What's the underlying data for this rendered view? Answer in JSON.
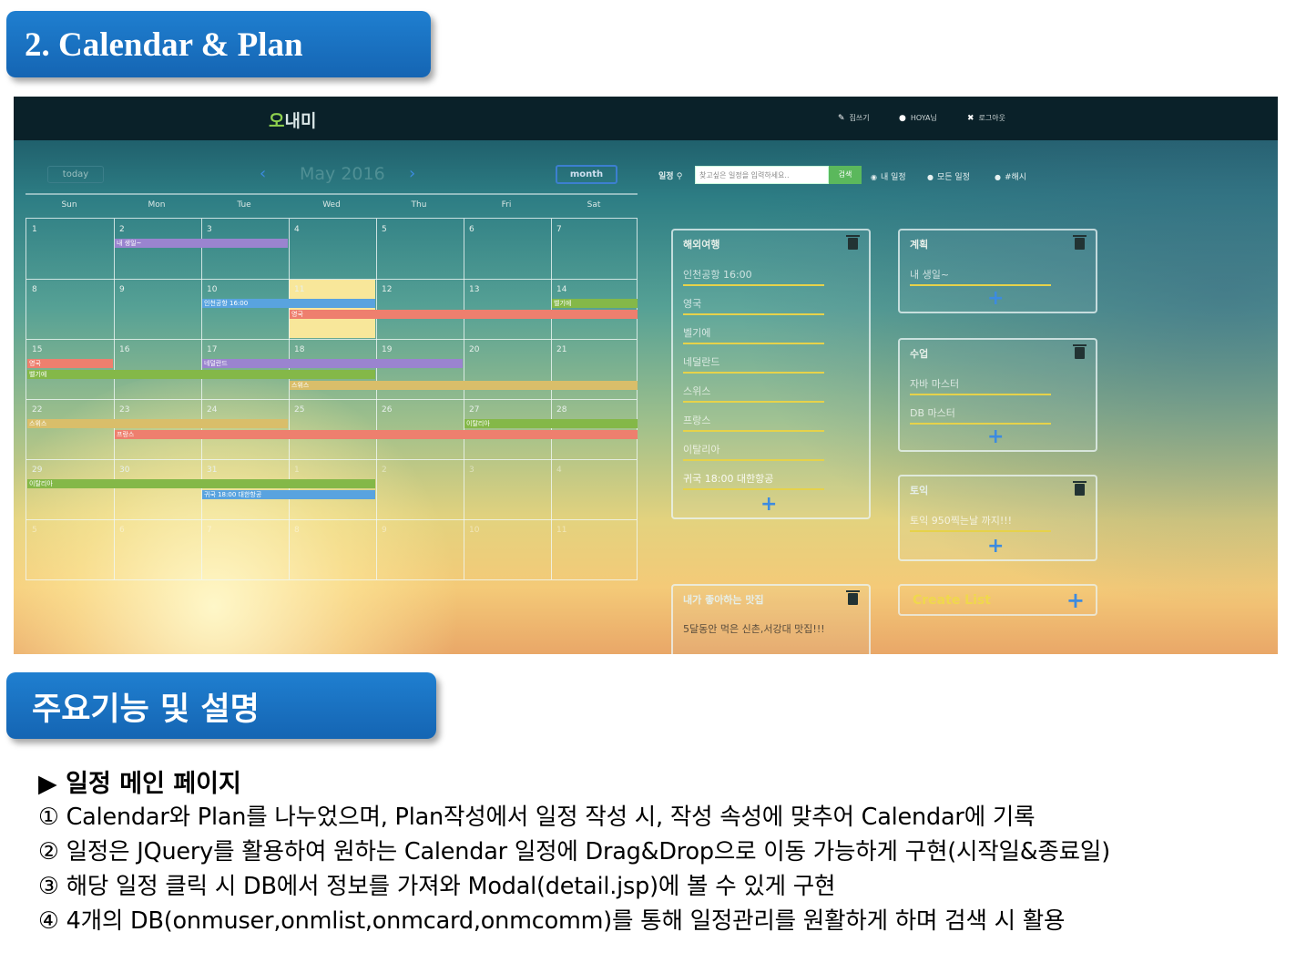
{
  "section1_title": "2. Calendar & Plan",
  "section2_title": "주요기능 및 설명",
  "app": {
    "brand": "오내미",
    "nav": {
      "write": "집쓰기",
      "user": "HOYA님",
      "logout": "로그아웃"
    }
  },
  "calendar": {
    "today_button": "today",
    "month_title": "May 2016",
    "month_button": "month",
    "weekdays": [
      "Sun",
      "Mon",
      "Tue",
      "Wed",
      "Thu",
      "Fri",
      "Sat"
    ],
    "weeks": [
      [
        "1",
        "2",
        "3",
        "4",
        "5",
        "6",
        "7"
      ],
      [
        "8",
        "9",
        "10",
        "11",
        "12",
        "13",
        "14"
      ],
      [
        "15",
        "16",
        "17",
        "18",
        "19",
        "20",
        "21"
      ],
      [
        "22",
        "23",
        "24",
        "25",
        "26",
        "27",
        "28"
      ],
      [
        "29",
        "30",
        "31",
        "1",
        "2",
        "3",
        "4"
      ],
      [
        "5",
        "6",
        "7",
        "8",
        "9",
        "10",
        "11"
      ]
    ],
    "events": [
      "내 생일~",
      "인천공항 16:00",
      "영국",
      "벨기에",
      "영국",
      "벨기에",
      "네덜란드",
      "스위스",
      "스위스",
      "프랑스",
      "이탈리아",
      "이탈리아",
      "귀국 18:00 대한항공"
    ]
  },
  "search": {
    "label": "일정",
    "placeholder": "찾고싶은 일정을 입력하세요..",
    "button": "검색",
    "options": [
      "내 일정",
      "모든 일정",
      "#해시"
    ]
  },
  "plans": {
    "travel": {
      "title": "해외여행",
      "items": [
        "인천공항 16:00",
        "영국",
        "벨기에",
        "네덜란드",
        "스위스",
        "프랑스",
        "이탈리아",
        "귀국 18:00 대한항공"
      ]
    },
    "plan": {
      "title": "계획",
      "items": [
        "내 생일~"
      ]
    },
    "class": {
      "title": "수업",
      "items": [
        "자바 마스터",
        "DB 마스터"
      ]
    },
    "toeic": {
      "title": "토익",
      "items": [
        "토익 950찍는날 까지!!!"
      ]
    },
    "food": {
      "title": "내가 좋아하는 맛집",
      "items": [
        "5달동안 먹은 신촌,서강대 맛집!!!"
      ]
    },
    "create_list": "Create List"
  },
  "description": {
    "heading": "일정 메인 페이지",
    "lines": [
      "① Calendar와 Plan를 나누었으며, Plan작성에서 일정 작성 시, 작성 속성에 맞추어 Calendar에 기록",
      "② 일정은 JQuery를 활용하여 원하는 Calendar 일정에 Drag&Drop으로 이동 가능하게 구현(시작일&종료일)",
      "③ 해당 일정 클릭 시 DB에서 정보를 가져와 Modal(detail.jsp)에 볼 수 있게 구현",
      "④ 4개의 DB(onmuser,onmlist,onmcard,onmcomm)를 통해 일정관리를 원활하게 하며 검색 시 활용"
    ]
  }
}
